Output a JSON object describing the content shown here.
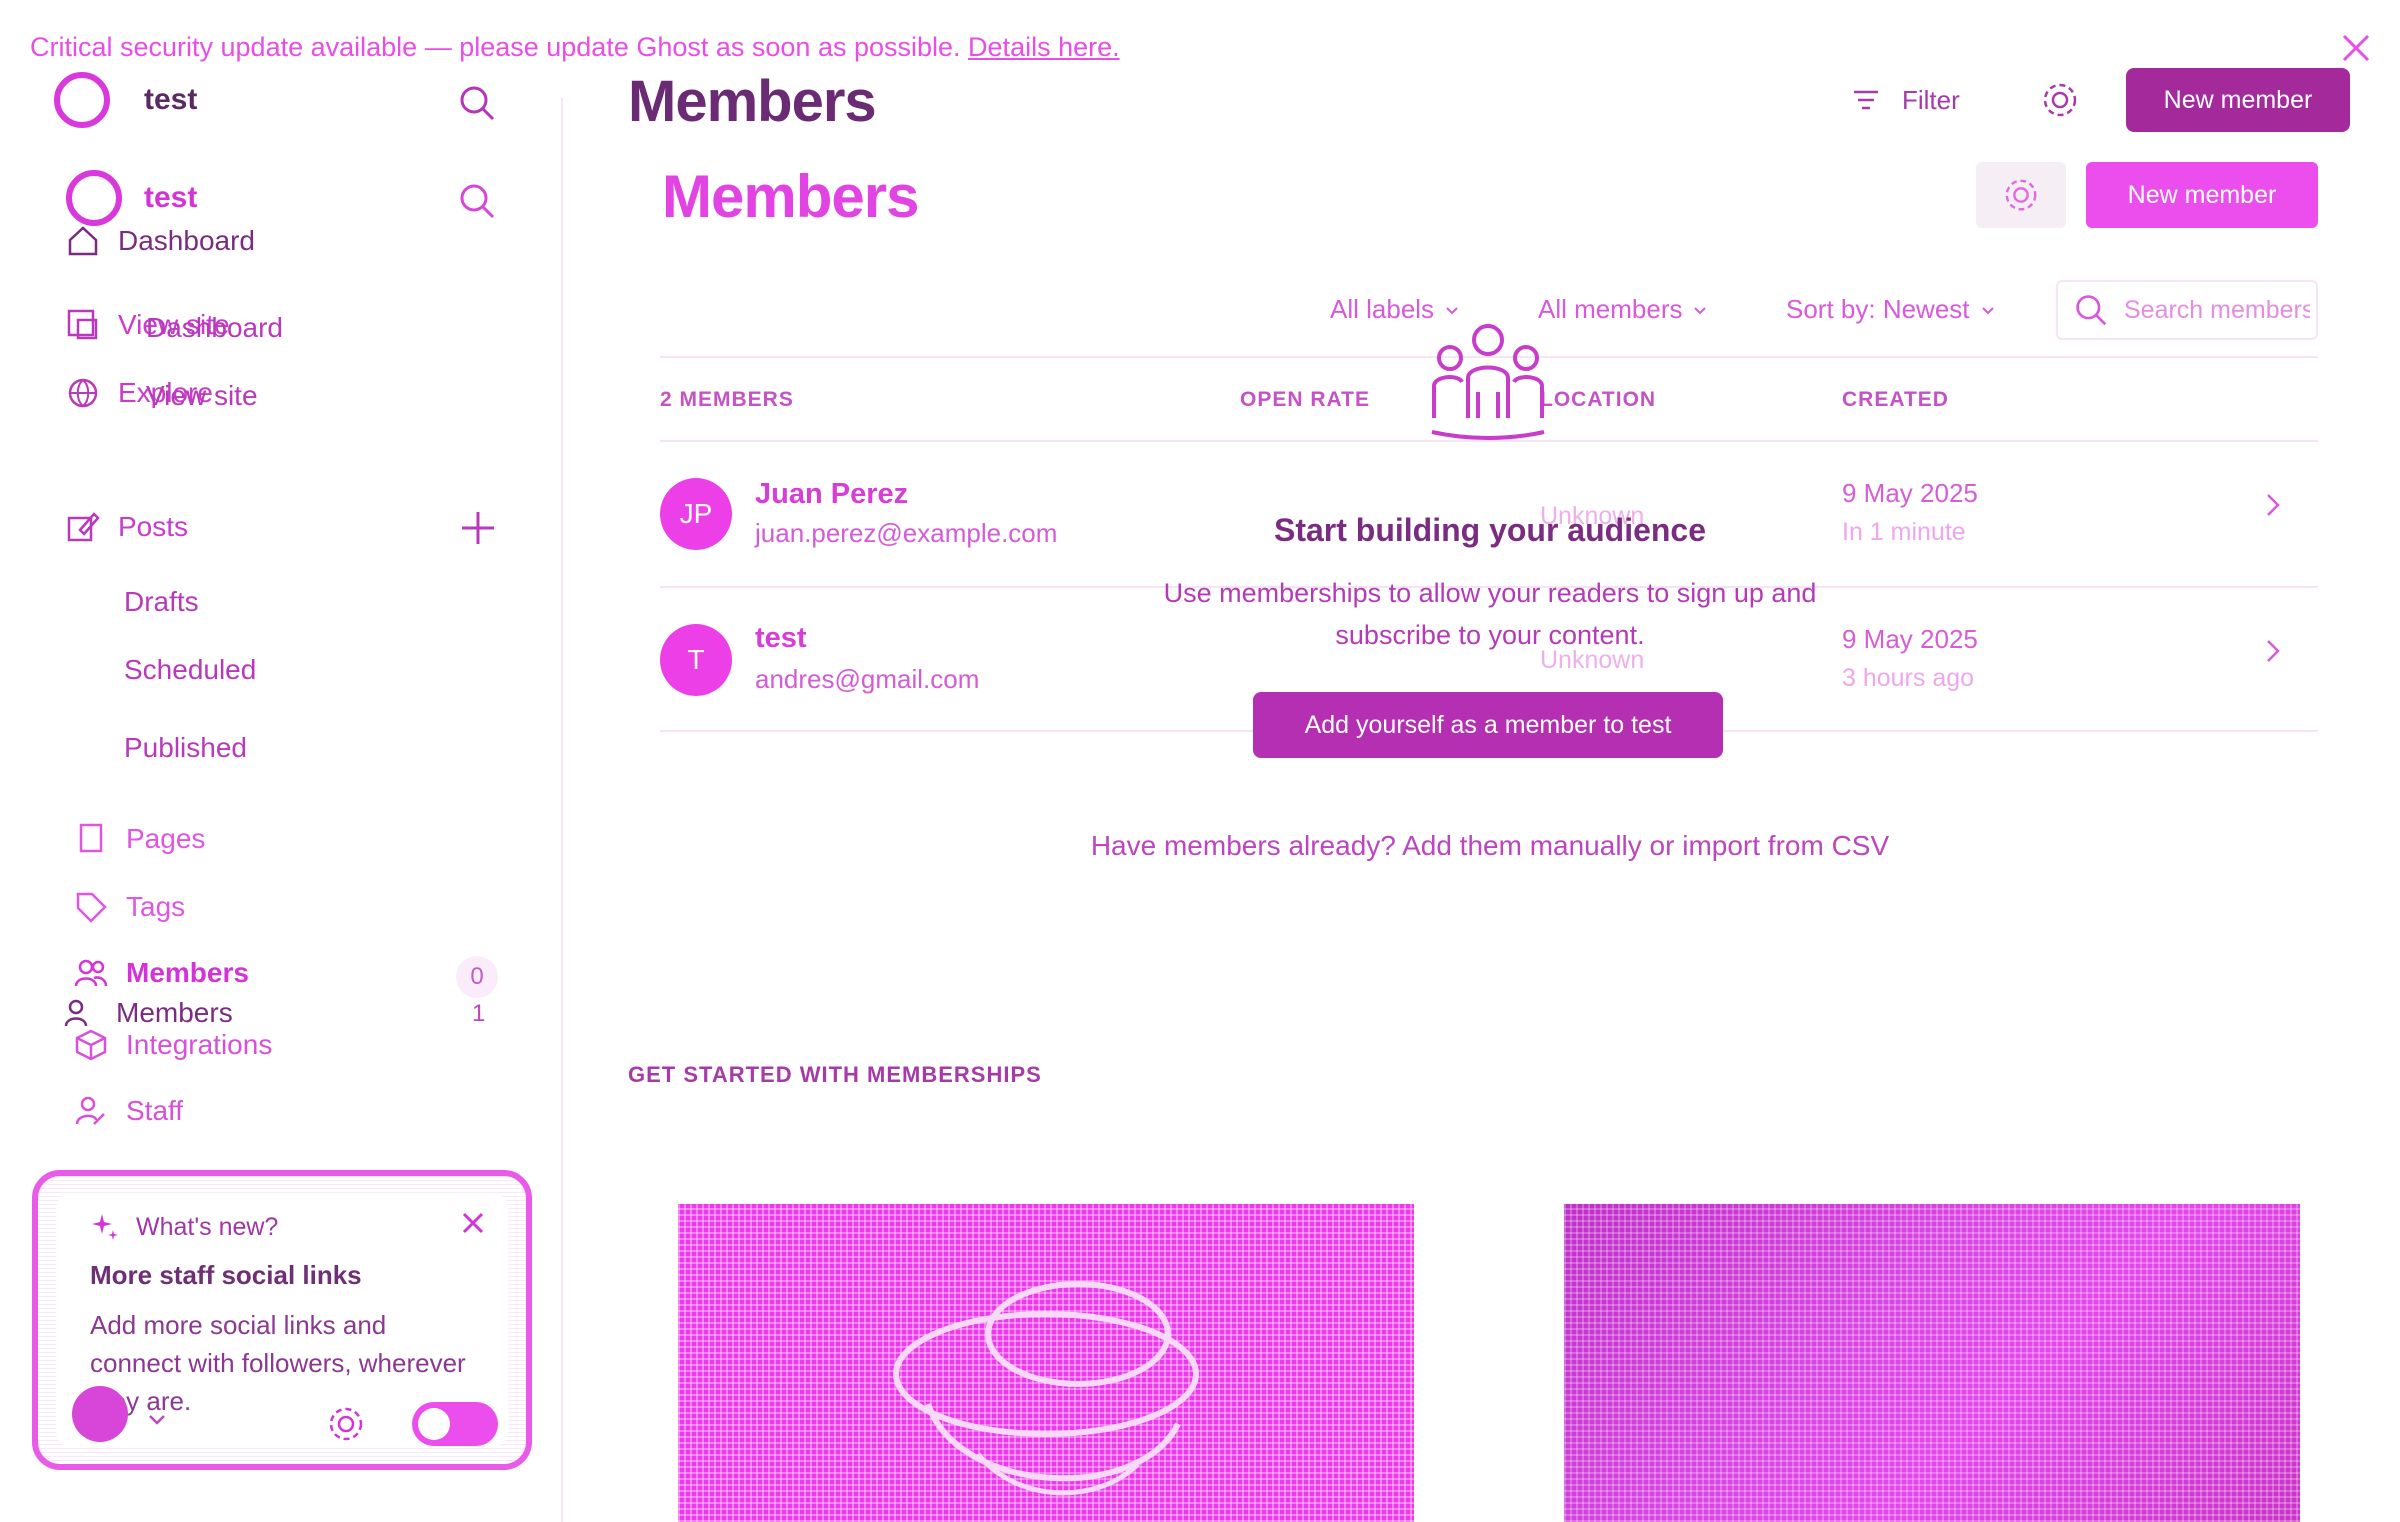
{
  "banner": {
    "text": "Critical security update available — please update Ghost as soon as possible.",
    "link": "Details here."
  },
  "site": {
    "name": "test"
  },
  "nav": {
    "dashboard": "Dashboard",
    "view_site": "View site",
    "explore": "Explore",
    "posts": "Posts",
    "drafts": "Drafts",
    "scheduled": "Scheduled",
    "published": "Published",
    "pages": "Pages",
    "tags": "Tags",
    "members": "Members",
    "members_count": "1",
    "members_badge": "0",
    "integrations": "Integrations",
    "staff": "Staff"
  },
  "whats_new": {
    "heading": "What's new?",
    "title": "More staff social links",
    "body": "Add more social links and connect with followers, wherever they are."
  },
  "header": {
    "title": "Members",
    "filter_label": "Filter",
    "new_member_label": "New member"
  },
  "toolbar": {
    "labels_filter": "All labels",
    "members_filter": "All members",
    "sort": "Sort by: Newest",
    "search_placeholder": "Search members..."
  },
  "table": {
    "count_header": "2 MEMBERS",
    "columns": {
      "open_rate": "OPEN RATE",
      "location": "LOCATION",
      "created": "CREATED"
    },
    "rows": [
      {
        "initials": "JP",
        "name": "Juan Perez",
        "email": "juan.perez@example.com",
        "location": "Unknown",
        "created": "9 May 2025",
        "ago": "In 1 minute"
      },
      {
        "initials": "T",
        "name": "test",
        "email": "andres@gmail.com",
        "location": "Unknown",
        "created": "9 May 2025",
        "ago": "3 hours ago"
      }
    ]
  },
  "empty_state": {
    "title": "Start building your audience",
    "description": "Use memberships to allow your readers to sign up and subscribe to your content.",
    "button": "Add yourself as a member to test",
    "import_text": "Have members already? Add them manually or import from CSV"
  },
  "get_started": {
    "label": "GET STARTED WITH MEMBERSHIPS"
  },
  "colors": {
    "accent": "#ec4ded",
    "dark_accent": "#a42a9c",
    "text_dark": "#6b2a74"
  }
}
